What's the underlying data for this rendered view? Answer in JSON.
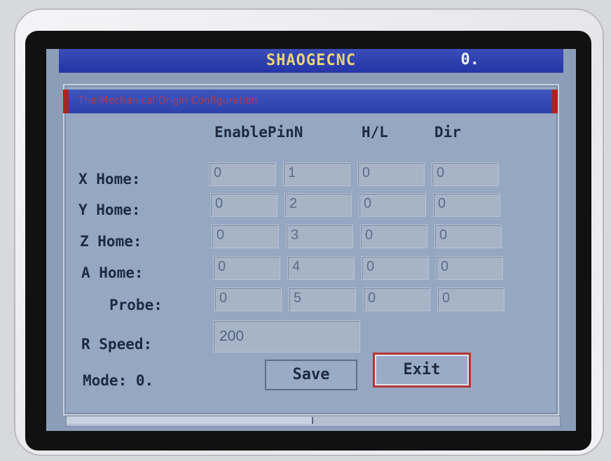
{
  "header": {
    "title": "SHAOGECNC",
    "counter": "0."
  },
  "dialog": {
    "title": "The Mechanical Origin Configuration",
    "columns": [
      "EnablePinN",
      "H/L",
      "Dir"
    ],
    "rows": [
      {
        "label": "X Home:",
        "values": [
          "0",
          "1",
          "0",
          "0"
        ]
      },
      {
        "label": "Y Home:",
        "values": [
          "0",
          "2",
          "0",
          "0"
        ]
      },
      {
        "label": "Z Home:",
        "values": [
          "0",
          "3",
          "0",
          "0"
        ]
      },
      {
        "label": "A Home:",
        "values": [
          "0",
          "4",
          "0",
          "0"
        ]
      },
      {
        "label": "Probe:",
        "values": [
          "0",
          "5",
          "0",
          "0"
        ]
      }
    ],
    "speed": {
      "label": "R Speed:",
      "value": "200"
    },
    "mode": {
      "label": "Mode:",
      "value": "0."
    },
    "buttons": {
      "save": "Save",
      "exit": "Exit"
    }
  },
  "colors": {
    "titlebar": "#2436a6",
    "title_text": "#e8d27a",
    "screen": "#8c9db8",
    "exit_border": "#b23636"
  }
}
